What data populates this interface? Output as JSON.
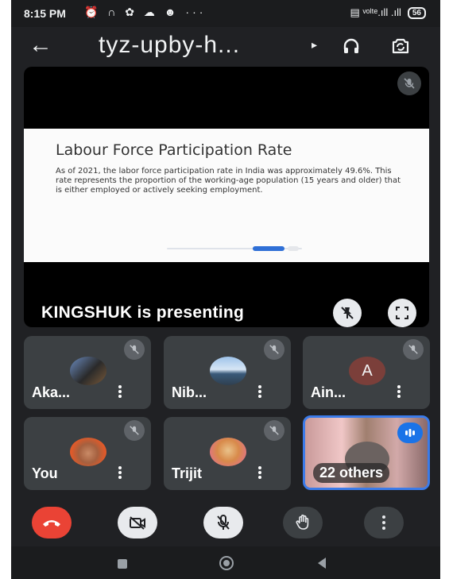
{
  "status_bar": {
    "time": "8:15 PM",
    "left_icons": "⏰ ∩ ✿ ☁ ☻ ···",
    "right_icons": "▤ ᵛᵒˡᵗᵉ.ıll .ıll",
    "battery": "56"
  },
  "app_bar": {
    "title": "tyz-upby-h...",
    "title_arrow": "▸",
    "back_icon": "←"
  },
  "presentation": {
    "slide_title": "Labour Force Participation Rate",
    "slide_body": "As of 2021, the labor force participation rate in India was approximately 49.6%. This rate represents the proportion of the working-age population (15 years and older) that is either employed or actively seeking employment.",
    "presenter_text": "KINGSHUK is presenting"
  },
  "participants": [
    {
      "name": "Aka..."
    },
    {
      "name": "Nib..."
    },
    {
      "name": "Ain...",
      "initial": "A"
    },
    {
      "name": "You"
    },
    {
      "name": "Trijit"
    }
  ],
  "others_tile": {
    "label": "22 others"
  },
  "colors": {
    "background": "#202124",
    "tile": "#3c4043",
    "end_call": "#ea4335",
    "accent": "#1a73e8"
  }
}
